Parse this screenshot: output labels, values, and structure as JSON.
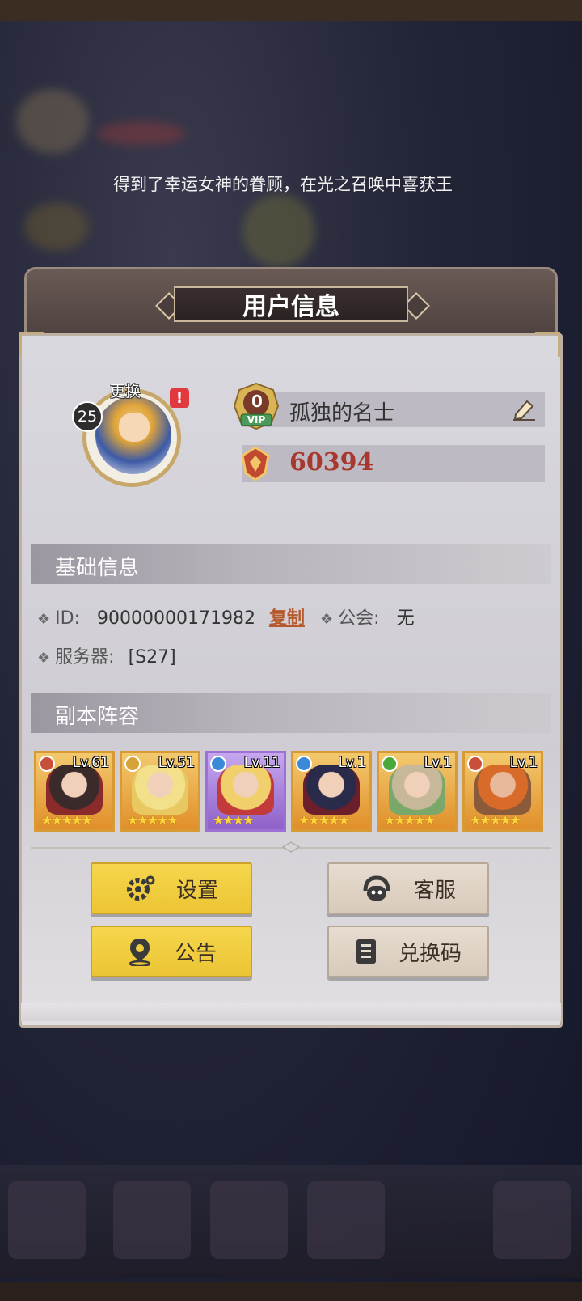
{
  "ticker": {
    "text": "得到了幸运女神的眷顾，在光之召唤中喜获王"
  },
  "modal": {
    "title": "用户信息"
  },
  "profile": {
    "level": "25",
    "change_label": "更换",
    "alert": "!",
    "vip_level": "0",
    "vip_label": "VIP",
    "name": "孤独的名士",
    "gold": "60394"
  },
  "basic_info": {
    "header": "基础信息",
    "id_label": "ID:",
    "id_value": "90000000171982",
    "copy_label": "复制",
    "guild_label": "公会:",
    "guild_value": "无",
    "server_label": "服务器:",
    "server_value": "[S27]"
  },
  "team": {
    "header": "副本阵容",
    "heroes": [
      {
        "level": "Lv.61",
        "stars": "★★★★★",
        "frame": "orange"
      },
      {
        "level": "Lv.51",
        "stars": "★★★★★",
        "frame": "orange"
      },
      {
        "level": "Lv.11",
        "stars": "★★★★",
        "frame": "purple"
      },
      {
        "level": "Lv.1",
        "stars": "★★★★★",
        "frame": "orange"
      },
      {
        "level": "Lv.1",
        "stars": "★★★★★",
        "frame": "orange"
      },
      {
        "level": "Lv.1",
        "stars": "★★★★★",
        "frame": "orange"
      }
    ]
  },
  "buttons": {
    "settings": "设置",
    "support": "客服",
    "notice": "公告",
    "redeem": "兑换码"
  },
  "colors": {
    "accent_yellow": "#f0cc3f",
    "gold_text": "#a8382e",
    "copy_link": "#b65a2e"
  }
}
